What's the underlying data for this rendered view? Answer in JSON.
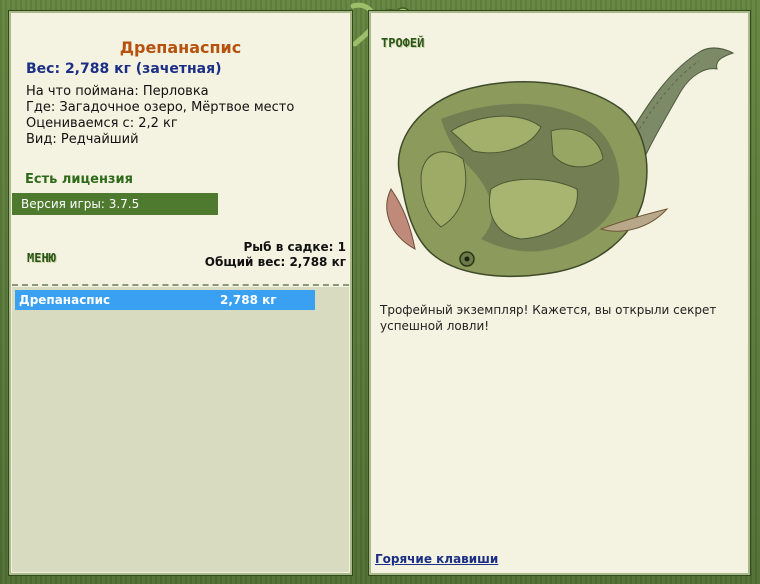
{
  "fish": {
    "name": "Дрепанаспис",
    "weight_line": "Вес: 2,788 кг (зачетная)",
    "bait_line": "На что поймана: Перловка",
    "location_line": "Где: Загадочное озеро, Мёртвое место",
    "value_line": "Оцениваемся с: 2,2 кг",
    "rarity_line": "Вид: Редчайший"
  },
  "license_text": "Есть лицензия",
  "version_text": "Версия игры: 3.7.5",
  "menu_label": "МЕНЮ",
  "stats": {
    "fish_count": "Рыб в садке: 1",
    "total_weight": "Общий вес: 2,788 кг"
  },
  "catch_list": [
    {
      "name": "Дрепанаспис",
      "weight": "2,788 кг"
    }
  ],
  "trophy": {
    "label": "ТРОФЕЙ",
    "message": "Трофейный экземпляр! Кажется, вы открыли секрет успешной ловли!"
  },
  "hotkeys_link": "Горячие клавиши",
  "colors": {
    "title": "#b5520e",
    "weight": "#1b2f86",
    "license": "#2f6a1a",
    "version_bar": "#4d7a2e",
    "selection": "#3aa0f2",
    "panel": "#f4f2e0",
    "frame": "#5b7a3e"
  }
}
